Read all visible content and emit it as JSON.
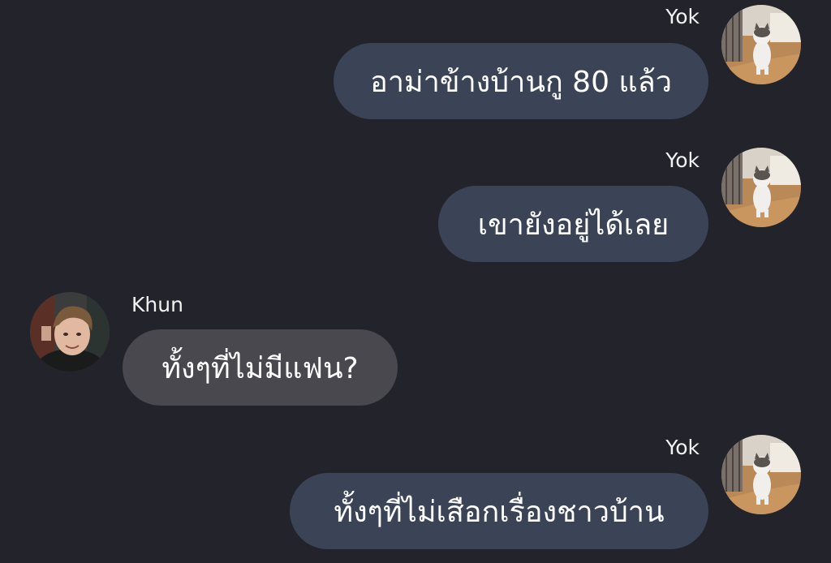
{
  "messages": [
    {
      "sender": "Yok",
      "side": "right",
      "text": "อาม่าข้างบ้านกู 80 แล้ว",
      "avatar": "cat-photo-avatar"
    },
    {
      "sender": "Yok",
      "side": "right",
      "text": "เขายังอยู่ได้เลย",
      "avatar": "cat-photo-avatar"
    },
    {
      "sender": "Khun",
      "side": "left",
      "text": "ทั้งๆที่ไม่มีแฟน?",
      "avatar": "person-photo-avatar"
    },
    {
      "sender": "Yok",
      "side": "right",
      "text": "ทั้งๆที่ไม่เสือกเรื่องชาวบ้าน",
      "avatar": "cat-photo-avatar"
    }
  ],
  "colors": {
    "background": "#23232b",
    "outgoing_bubble": "#3b4457",
    "incoming_bubble": "#48484e",
    "text": "#ffffff"
  }
}
